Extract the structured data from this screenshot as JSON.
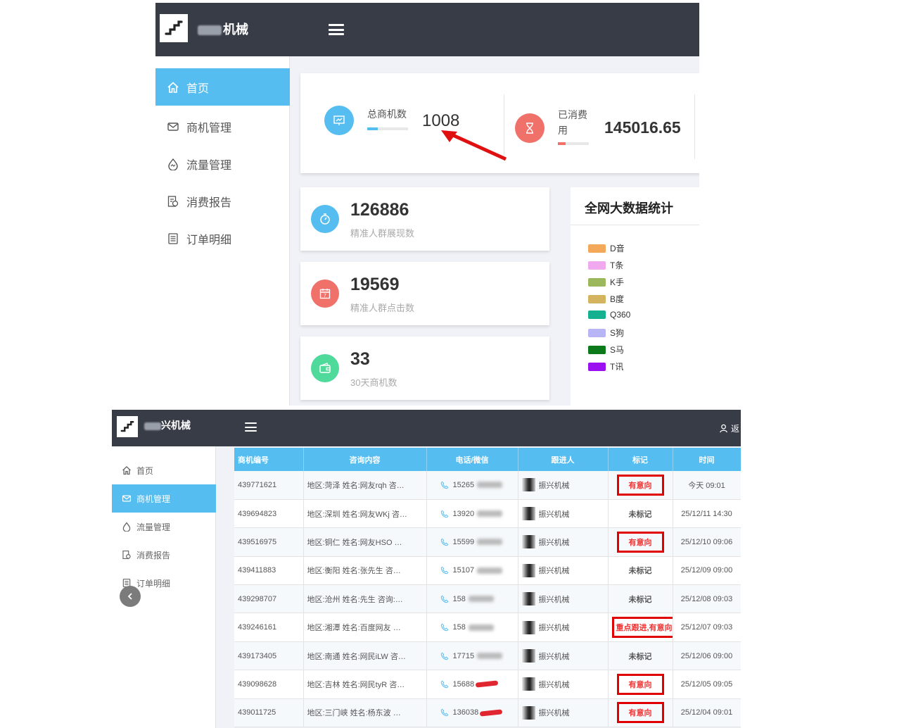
{
  "dashboard": {
    "brand": "机械",
    "nav": [
      {
        "label": "首页",
        "icon": "home-icon",
        "active": true
      },
      {
        "label": "商机管理",
        "icon": "mail-icon",
        "active": false
      },
      {
        "label": "流量管理",
        "icon": "traffic-icon",
        "active": false
      },
      {
        "label": "消费报告",
        "icon": "report-icon",
        "active": false
      },
      {
        "label": "订单明细",
        "icon": "order-icon",
        "active": false
      }
    ],
    "stats": {
      "total_leads": {
        "label": "总商机数",
        "value": "1008",
        "progress": 0.25,
        "icon": "chart-icon",
        "color": "#56bdf0"
      },
      "spent": {
        "label_line1": "已消费",
        "label_line2": "用",
        "value": "145016.65",
        "progress": 0.25,
        "icon": "hourglass-icon",
        "color": "#f0706a"
      }
    },
    "metrics": [
      {
        "value": "126886",
        "label": "精准人群展现数",
        "icon": "stopwatch-icon",
        "color": "#56bdf0"
      },
      {
        "value": "19569",
        "label": "精准人群点击数",
        "icon": "calendar-icon",
        "color": "#f0706a"
      },
      {
        "value": "33",
        "label": "30天商机数",
        "icon": "wallet-icon",
        "color": "#4fd99b"
      }
    ],
    "bigdata": {
      "title": "全网大数据统计",
      "legend": [
        {
          "name": "D音",
          "color": "#f4a95a"
        },
        {
          "name": "T条",
          "color": "#f0a8ef"
        },
        {
          "name": "K手",
          "color": "#9bb95c"
        },
        {
          "name": "B度",
          "color": "#d5b45f"
        },
        {
          "name": "Q360",
          "color": "#14b090"
        },
        {
          "name": "S狗",
          "color": "#b7b5f5"
        },
        {
          "name": "S马",
          "color": "#0c7a1a"
        },
        {
          "name": "T讯",
          "color": "#9b10f0"
        }
      ]
    }
  },
  "leads_page": {
    "brand": "兴机械",
    "user_label": "返",
    "nav": [
      {
        "label": "首页",
        "icon": "home-icon",
        "active": false
      },
      {
        "label": "商机管理",
        "icon": "mail-icon",
        "active": true
      },
      {
        "label": "流量管理",
        "icon": "traffic-icon",
        "active": false
      },
      {
        "label": "消费报告",
        "icon": "report-icon",
        "active": false
      },
      {
        "label": "订单明细",
        "icon": "order-icon",
        "active": false
      }
    ],
    "table": {
      "columns": [
        "商机编号",
        "咨询内容",
        "电话/微信",
        "跟进人",
        "标记",
        "时间"
      ],
      "rows": [
        {
          "id": "439771621",
          "content": "地区:菏泽 姓名:网友rqh 咨…",
          "phone": "15265",
          "follower": "振兴机械",
          "mark": "有意向",
          "time": "今天 09:01"
        },
        {
          "id": "439694823",
          "content": "地区:深圳 姓名:网友WKj 咨…",
          "phone": "13920",
          "follower": "振兴机械",
          "mark": "未标记",
          "time": "25/12/11 14:30"
        },
        {
          "id": "439516975",
          "content": "地区:铜仁 姓名:网友HSO …",
          "phone": "15599",
          "follower": "振兴机械",
          "mark": "有意向",
          "time": "25/12/10 09:06"
        },
        {
          "id": "439411883",
          "content": "地区:衡阳 姓名:张先生 咨…",
          "phone": "15107",
          "follower": "振兴机械",
          "mark": "未标记",
          "time": "25/12/09 09:00"
        },
        {
          "id": "439298707",
          "content": "地区:沧州 姓名:先生 咨询:…",
          "phone": "158",
          "follower": "振兴机械",
          "mark": "未标记",
          "time": "25/12/08 09:03"
        },
        {
          "id": "439246161",
          "content": "地区:湘潭 姓名:百度网友 …",
          "phone": "158",
          "follower": "振兴机械",
          "mark": "重点跟进,有意向",
          "time": "25/12/07 09:03"
        },
        {
          "id": "439173405",
          "content": "地区:南通 姓名:网民iLW 咨…",
          "phone": "17715",
          "follower": "振兴机械",
          "mark": "未标记",
          "time": "25/12/06 09:00"
        },
        {
          "id": "439098628",
          "content": "地区:吉林 姓名:网民tyR 咨…",
          "phone": "15688",
          "follower": "振兴机械",
          "mark": "有意向",
          "time": "25/12/05 09:05"
        },
        {
          "id": "439011725",
          "content": "地区:三门峡 姓名:杨东波 …",
          "phone": "136038",
          "follower": "振兴机械",
          "mark": "有意向",
          "time": "25/12/04 09:01"
        }
      ]
    }
  }
}
